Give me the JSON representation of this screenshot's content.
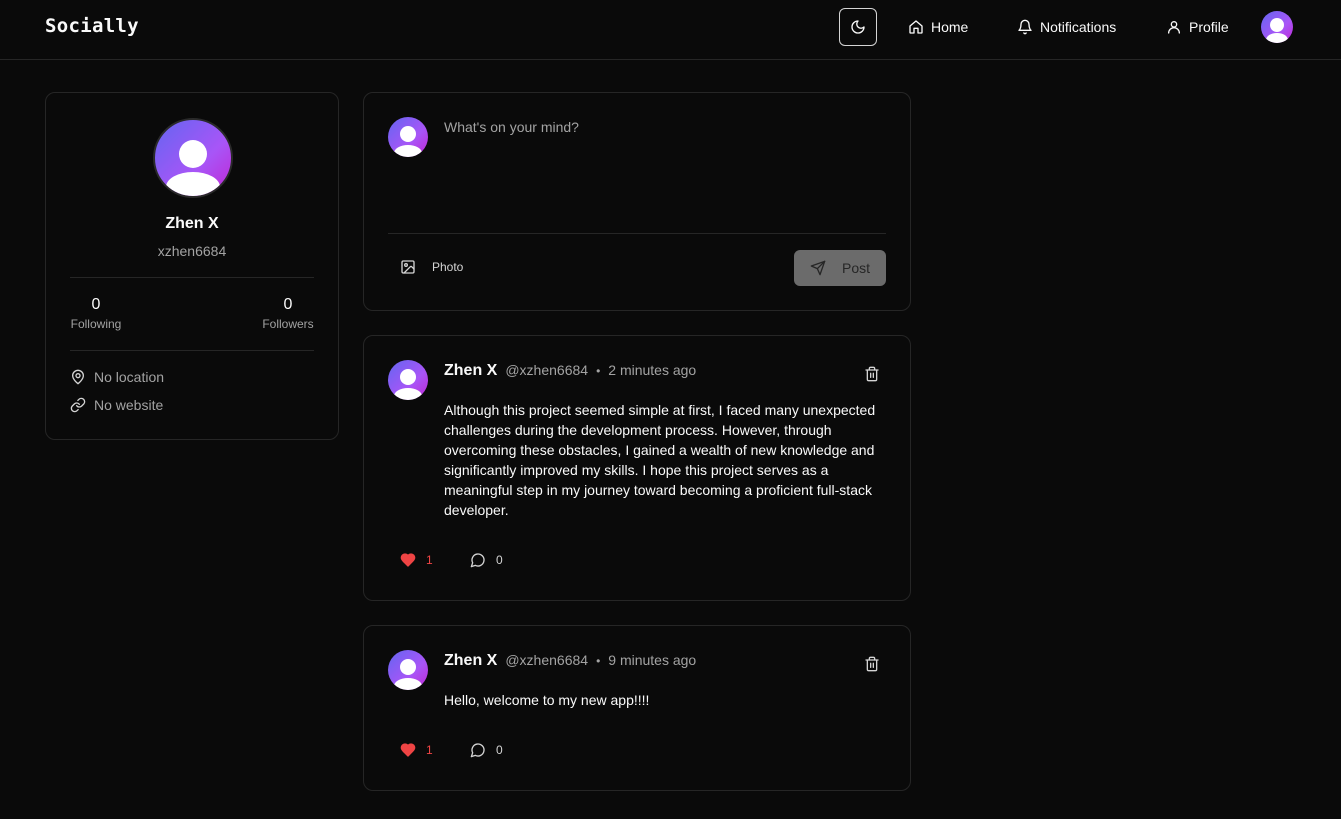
{
  "navbar": {
    "brand": "Socially",
    "home_label": "Home",
    "notifications_label": "Notifications",
    "profile_label": "Profile"
  },
  "profile": {
    "name": "Zhen X",
    "username": "xzhen6684",
    "following_count": "0",
    "following_label": "Following",
    "followers_count": "0",
    "followers_label": "Followers",
    "location": "No location",
    "website": "No website"
  },
  "composer": {
    "placeholder": "What's on your mind?",
    "photo_label": "Photo",
    "post_label": "Post"
  },
  "posts": [
    {
      "author": "Zhen X",
      "handle": "@xzhen6684",
      "separator": "•",
      "time": "2 minutes ago",
      "content": "Although this project seemed simple at first, I faced many unexpected challenges during the development process. However, through overcoming these obstacles, I gained a wealth of new knowledge and significantly improved my skills. I hope this project serves as a meaningful step in my journey toward becoming a proficient full-stack developer.",
      "likes": "1",
      "comments": "0"
    },
    {
      "author": "Zhen X",
      "handle": "@xzhen6684",
      "separator": "•",
      "time": "9 minutes ago",
      "content": "Hello, welcome to my new app!!!!",
      "likes": "1",
      "comments": "0"
    }
  ],
  "colors": {
    "background": "#0a0a0a",
    "border": "#262626",
    "like": "#ef4444",
    "avatar_gradient_start": "#6366f1",
    "avatar_gradient_end": "#c026d3"
  },
  "icons": {
    "theme_toggle": "moon-icon",
    "home": "home-icon",
    "notifications": "bell-icon",
    "profile": "user-icon",
    "location": "map-pin-icon",
    "website": "link-icon",
    "photo": "image-icon",
    "post": "send-icon",
    "delete": "trash-icon",
    "like": "heart-icon",
    "comment": "message-circle-icon"
  }
}
